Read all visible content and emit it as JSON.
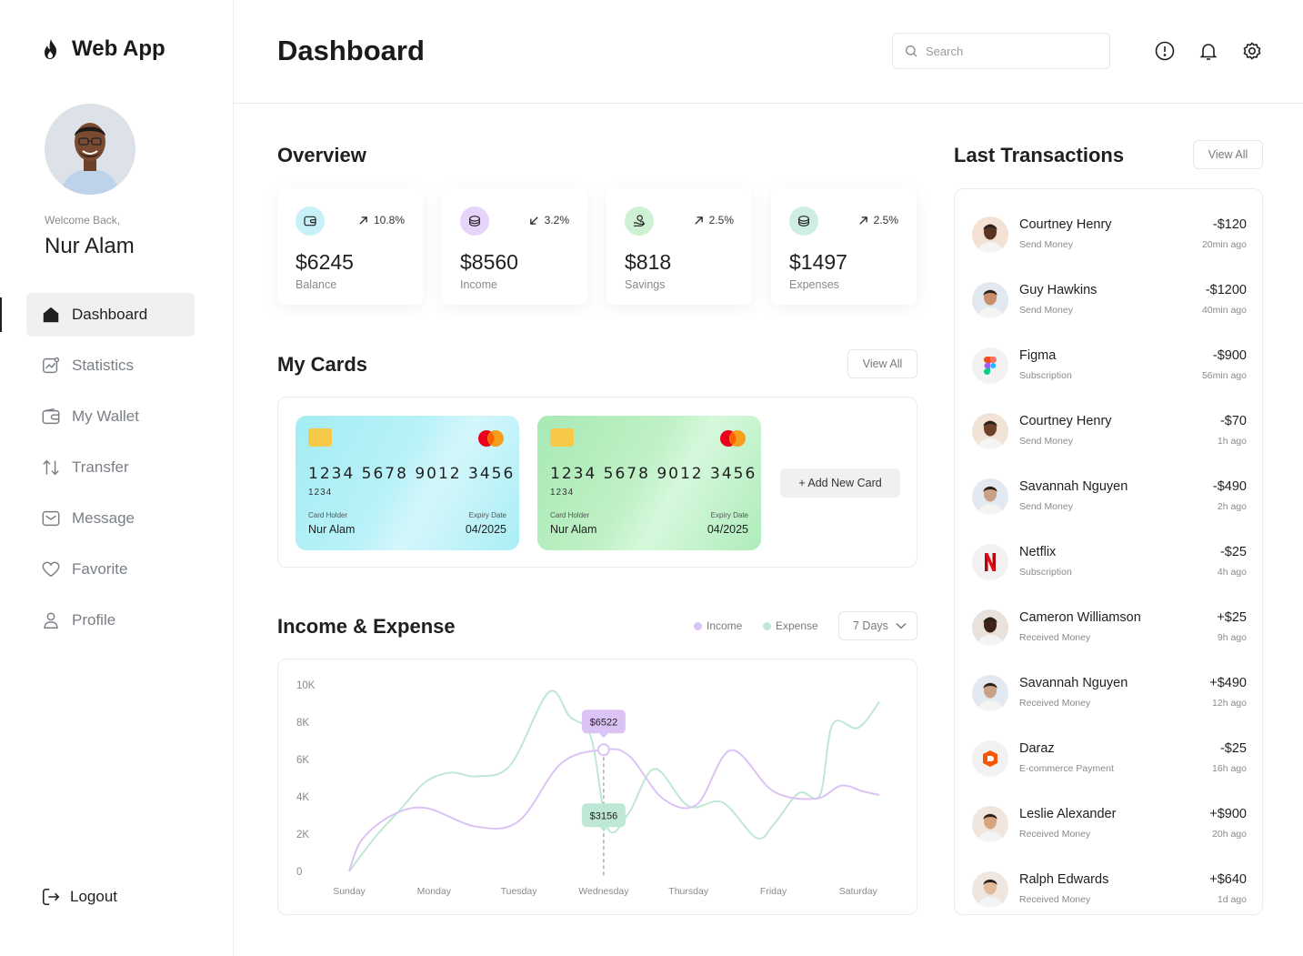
{
  "brand": {
    "name": "Web App"
  },
  "user": {
    "welcome": "Welcome Back,",
    "name": "Nur Alam"
  },
  "nav": {
    "items": [
      {
        "label": "Dashboard",
        "icon": "home-icon",
        "active": true
      },
      {
        "label": "Statistics",
        "icon": "statistics-icon",
        "active": false
      },
      {
        "label": "My Wallet",
        "icon": "wallet-icon",
        "active": false
      },
      {
        "label": "Transfer",
        "icon": "transfer-icon",
        "active": false
      },
      {
        "label": "Message",
        "icon": "message-icon",
        "active": false
      },
      {
        "label": "Favorite",
        "icon": "heart-icon",
        "active": false
      },
      {
        "label": "Profile",
        "icon": "profile-icon",
        "active": false
      }
    ],
    "logout": "Logout"
  },
  "header": {
    "title": "Dashboard",
    "search_placeholder": "Search"
  },
  "overview": {
    "title": "Overview",
    "stats": [
      {
        "value": "$6245",
        "label": "Balance",
        "change": "10.8%",
        "direction": "up",
        "color": "#c8f1f7"
      },
      {
        "value": "$8560",
        "label": "Income",
        "change": "3.2%",
        "direction": "down",
        "color": "#e7d4fb"
      },
      {
        "value": "$818",
        "label": "Savings",
        "change": "2.5%",
        "direction": "up",
        "color": "#cff1d3"
      },
      {
        "value": "$1497",
        "label": "Expenses",
        "change": "2.5%",
        "direction": "up",
        "color": "#cdeee1"
      }
    ]
  },
  "cards": {
    "title": "My Cards",
    "view_all": "View All",
    "add_new": "+ Add New Card",
    "items": [
      {
        "number": "1234 5678 9012 3456",
        "sub": "1234",
        "holder_label": "Card Holder",
        "holder": "Nur Alam",
        "expiry_label": "Expiry Date",
        "expiry": "04/2025",
        "brand": "mastercard"
      },
      {
        "number": "1234 5678 9012 3456",
        "sub": "1234",
        "holder_label": "Card Holder",
        "holder": "Nur Alam",
        "expiry_label": "Expiry Date",
        "expiry": "04/2025",
        "brand": "mastercard"
      }
    ]
  },
  "income_expense": {
    "title": "Income & Expense",
    "legend_income": "Income",
    "legend_expense": "Expense",
    "range": "7 Days",
    "colors": {
      "income": "#dcc3f6",
      "expense": "#bfe7d5"
    }
  },
  "chart_data": {
    "type": "line",
    "title": "Income & Expense",
    "categories": [
      "Sunday",
      "Monday",
      "Tuesday",
      "Wednesday",
      "Thursday",
      "Friday",
      "Saturday"
    ],
    "y_ticks": [
      "10K",
      "8K",
      "6K",
      "4K",
      "2K",
      "0"
    ],
    "ylim": [
      0,
      10000
    ],
    "series": [
      {
        "name": "Income",
        "color": "#dcc3f6",
        "x": [
          0,
          0.15,
          0.5,
          0.9,
          1.5,
          2.0,
          2.5,
          3.0,
          3.3,
          3.7,
          4.1,
          4.5,
          5.0,
          5.5,
          5.8,
          6.05,
          6.25
        ],
        "y": [
          0,
          1700,
          3000,
          3400,
          2400,
          2700,
          5800,
          6522,
          6200,
          3900,
          3600,
          6500,
          4300,
          3900,
          4600,
          4300,
          4100
        ]
      },
      {
        "name": "Expense",
        "color": "#bfe7d5",
        "x": [
          0,
          0.3,
          0.6,
          0.9,
          1.2,
          1.5,
          1.9,
          2.35,
          2.6,
          2.85,
          3.05,
          3.3,
          3.6,
          4.0,
          4.4,
          4.8,
          5.0,
          5.3,
          5.55,
          5.7,
          6.0,
          6.25
        ],
        "y": [
          0,
          1800,
          3300,
          4800,
          5300,
          5100,
          5700,
          9600,
          8300,
          7200,
          2300,
          3156,
          5500,
          3500,
          3700,
          1800,
          2500,
          4200,
          4100,
          7900,
          7700,
          9100
        ]
      }
    ],
    "annotations": [
      {
        "series": "Income",
        "x": 3.0,
        "y": 6522,
        "label": "$6522"
      },
      {
        "series": "Expense",
        "x": 3.0,
        "y": 3156,
        "label": "$3156"
      }
    ],
    "grid": false,
    "legend": "top-right"
  },
  "transactions": {
    "title": "Last Transactions",
    "view_all": "View All",
    "items": [
      {
        "name": "Courtney Henry",
        "type": "Send Money",
        "amount": "-$120",
        "time": "20min ago",
        "avatar": "person-avatar"
      },
      {
        "name": "Guy Hawkins",
        "type": "Send Money",
        "amount": "-$1200",
        "time": "40min ago",
        "avatar": "person-avatar"
      },
      {
        "name": "Figma",
        "type": "Subscription",
        "amount": "-$900",
        "time": "56min ago",
        "avatar": "figma-logo"
      },
      {
        "name": "Courtney Henry",
        "type": "Send Money",
        "amount": "-$70",
        "time": "1h ago",
        "avatar": "person-avatar"
      },
      {
        "name": "Savannah Nguyen",
        "type": "Send Money",
        "amount": "-$490",
        "time": "2h ago",
        "avatar": "person-avatar"
      },
      {
        "name": "Netflix",
        "type": "Subscription",
        "amount": "-$25",
        "time": "4h ago",
        "avatar": "netflix-logo"
      },
      {
        "name": "Cameron Williamson",
        "type": "Received Money",
        "amount": "+$25",
        "time": "9h ago",
        "avatar": "person-avatar"
      },
      {
        "name": "Savannah Nguyen",
        "type": "Received Money",
        "amount": "+$490",
        "time": "12h ago",
        "avatar": "person-avatar"
      },
      {
        "name": "Daraz",
        "type": "E-commerce Payment",
        "amount": "-$25",
        "time": "16h ago",
        "avatar": "daraz-logo"
      },
      {
        "name": "Leslie Alexander",
        "type": "Received Money",
        "amount": "+$900",
        "time": "20h ago",
        "avatar": "person-avatar"
      },
      {
        "name": "Ralph Edwards",
        "type": "Received Money",
        "amount": "+$640",
        "time": "1d ago",
        "avatar": "person-avatar"
      }
    ]
  }
}
